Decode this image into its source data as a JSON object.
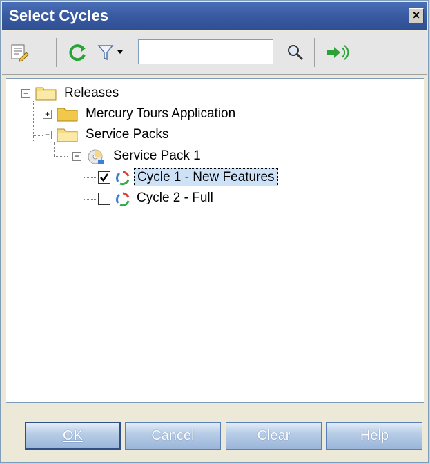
{
  "window": {
    "title": "Select Cycles",
    "close_glyph": "×"
  },
  "toolbar": {
    "items": [
      {
        "icon": "edit-details-icon"
      },
      {
        "icon": "refresh-icon"
      },
      {
        "icon": "filter-icon"
      },
      {
        "icon": "search-icon"
      },
      {
        "icon": "go-to-icon"
      }
    ],
    "search_value": "",
    "search_placeholder": ""
  },
  "tree": {
    "root": {
      "label": "Releases",
      "expander": "−"
    },
    "release_1": {
      "label": "Mercury Tours Application",
      "expander": "+"
    },
    "release_2": {
      "label": "Service Packs",
      "expander": "−"
    },
    "cycle_folder": {
      "label": "Service Pack 1",
      "expander": "−"
    },
    "cycles": [
      {
        "label": "Cycle 1 - New Features",
        "checked": true
      },
      {
        "label": "Cycle 2 - Full",
        "checked": false
      }
    ]
  },
  "buttons": {
    "ok": "OK",
    "cancel": "Cancel",
    "clear": "Clear",
    "help": "Help"
  },
  "colors": {
    "titlebar": "#3a5ca3",
    "folder": "#f2d066",
    "cycle_red": "#d9403a",
    "cycle_green": "#38a84a",
    "cycle_blue": "#3a7fd9",
    "selection": "#cde1f7"
  }
}
